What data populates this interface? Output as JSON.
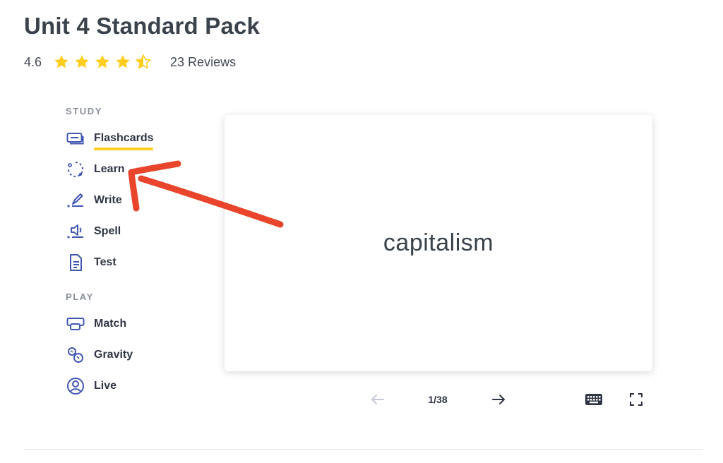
{
  "header": {
    "title": "Unit 4 Standard Pack",
    "rating": "4.6",
    "stars": 4.5,
    "reviews": "23 Reviews"
  },
  "sidebar": {
    "study_label": "STUDY",
    "study_items": [
      {
        "label": "Flashcards",
        "icon": "flashcards-icon",
        "active": true
      },
      {
        "label": "Learn",
        "icon": "learn-icon"
      },
      {
        "label": "Write",
        "icon": "write-icon"
      },
      {
        "label": "Spell",
        "icon": "spell-icon"
      },
      {
        "label": "Test",
        "icon": "test-icon"
      }
    ],
    "play_label": "PLAY",
    "play_items": [
      {
        "label": "Match",
        "icon": "match-icon"
      },
      {
        "label": "Gravity",
        "icon": "gravity-icon"
      },
      {
        "label": "Live",
        "icon": "live-icon"
      }
    ]
  },
  "card": {
    "term": "capitalism"
  },
  "controls": {
    "counter": "1/38"
  },
  "colors": {
    "accent_yellow": "#ffcd1f",
    "icon_blue": "#4257b2",
    "annotation_red": "#e8452c",
    "star": "#ffcd1f"
  }
}
